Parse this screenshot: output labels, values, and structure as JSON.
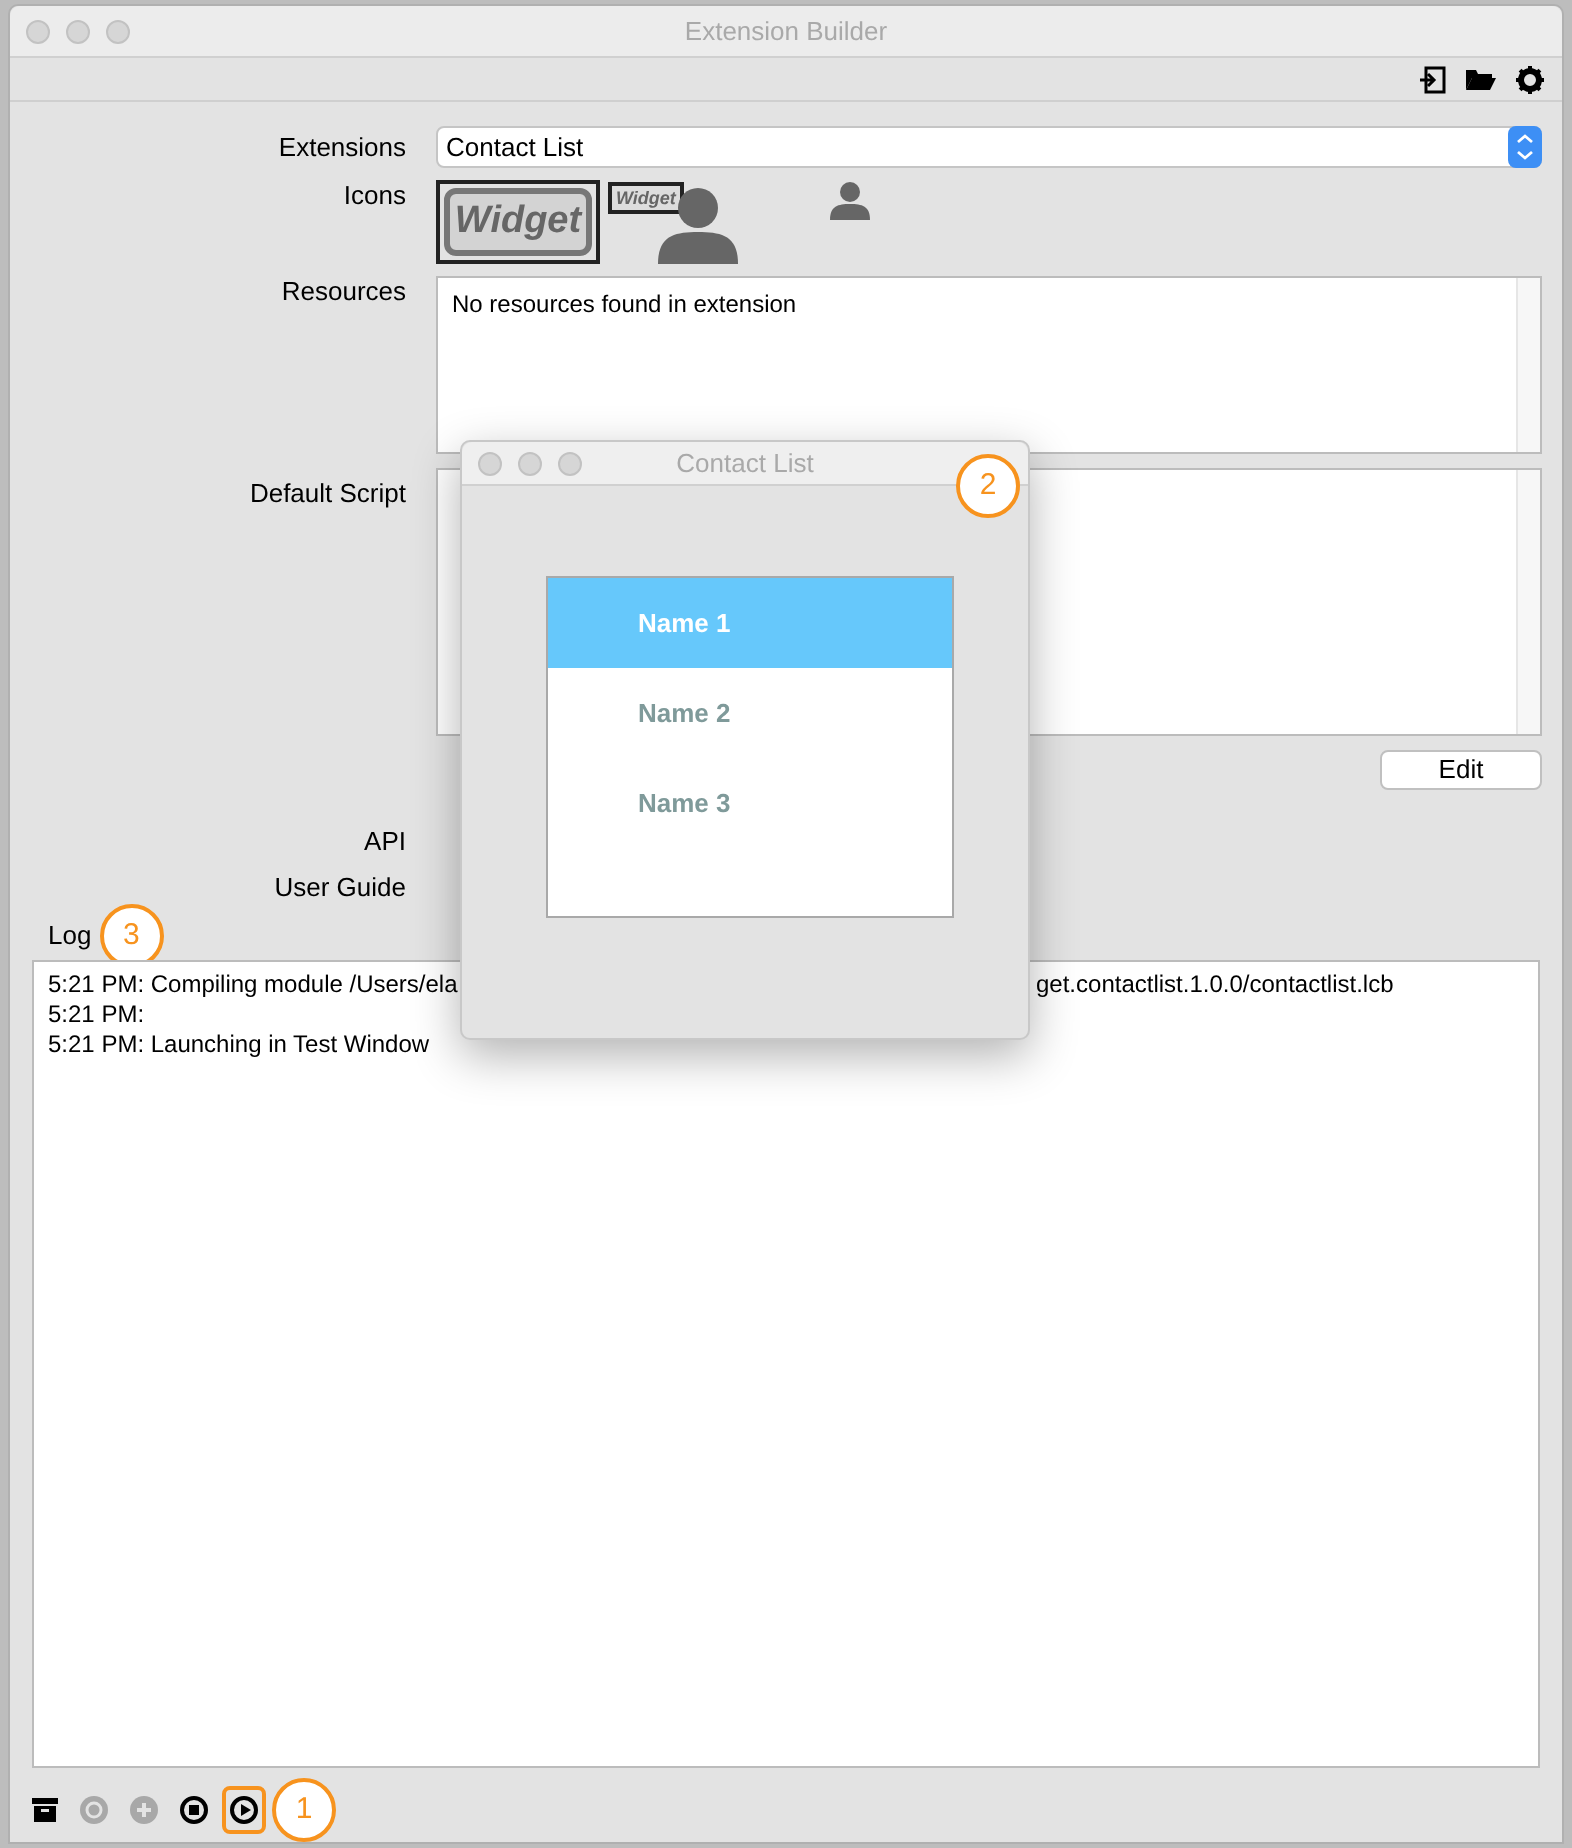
{
  "window": {
    "title": "Extension Builder"
  },
  "toolbar": {
    "items": [
      {
        "kind": "export"
      },
      {
        "kind": "folder"
      },
      {
        "kind": "settings"
      }
    ]
  },
  "form": {
    "extensions": {
      "label": "Extensions",
      "value": "Contact List"
    },
    "icons": {
      "label": "Icons",
      "items": [
        {
          "kind": "widget-logo",
          "text": "Widget",
          "selected": true
        },
        {
          "kind": "widget-logo-person",
          "text": "Widget",
          "selected": false
        },
        {
          "kind": "person",
          "selected": false
        }
      ]
    },
    "resources": {
      "label": "Resources",
      "text": "No resources found in extension"
    },
    "default_script": {
      "label": "Default Script"
    },
    "edit_button": "Edit",
    "api": {
      "label": "API"
    },
    "user_guide": {
      "label": "User Guide"
    }
  },
  "log": {
    "label": "Log",
    "callout": "3",
    "lines": [
      {
        "left": "5:21 PM: Compiling module /Users/ela",
        "right": "get.contactlist.1.0.0/contactlist.lcb"
      },
      {
        "left": "5:21 PM:"
      },
      {
        "left": "5:21 PM: Launching in Test Window"
      }
    ]
  },
  "bottom_toolbar": {
    "items": [
      {
        "kind": "archive",
        "disabled": false,
        "highlighted": false
      },
      {
        "kind": "settings",
        "disabled": true,
        "highlighted": false
      },
      {
        "kind": "add",
        "disabled": true,
        "highlighted": false
      },
      {
        "kind": "stop",
        "disabled": false,
        "highlighted": false
      },
      {
        "kind": "play",
        "disabled": false,
        "highlighted": true
      }
    ],
    "callout": "1"
  },
  "popup": {
    "title": "Contact List",
    "callout": "2",
    "items": [
      {
        "name": "Name 1",
        "selected": true
      },
      {
        "name": "Name 2",
        "selected": false
      },
      {
        "name": "Name 3",
        "selected": false
      }
    ]
  }
}
